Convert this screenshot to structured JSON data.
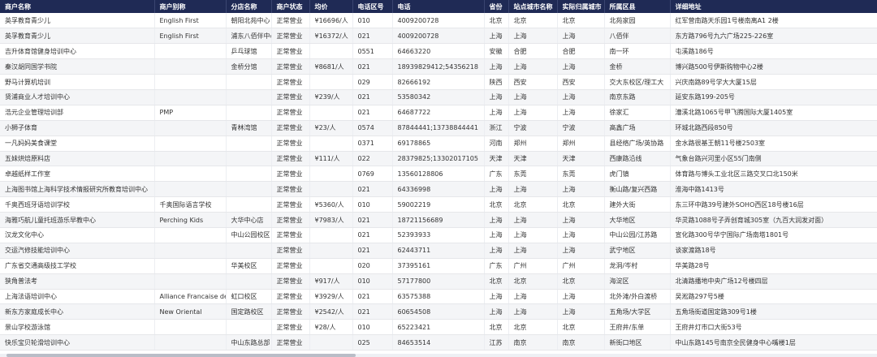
{
  "table": {
    "columns": [
      "商户名称",
      "商户别称",
      "分店名称",
      "商户状态",
      "均价",
      "电话区号",
      "电话",
      "省份",
      "站点城市名称",
      "实际归属城市",
      "所属区县",
      "详细地址"
    ],
    "rows": [
      [
        "英孚教育青少儿",
        "English First",
        "朝阳北苑中心",
        "正常营业",
        "¥16696/人",
        "010",
        "4009200728",
        "北京",
        "北京",
        "北京",
        "北苑家园",
        "红军营南路天乐园1号楼南离A1 2楼"
      ],
      [
        "英孚教育青少儿",
        "English First",
        "浦东八佰伴中心",
        "正常营业",
        "¥16372/人",
        "021",
        "4009200728",
        "上海",
        "上海",
        "上海",
        "八佰伴",
        "东方路796号九六广场225-226室"
      ],
      [
        "吉升体育馆健身培训中心",
        "",
        "乒乓球馆",
        "正常营业",
        "",
        "0551",
        "64663220",
        "安徽",
        "合肥",
        "合肥",
        "南一环",
        "屯溪路186号"
      ],
      [
        "秦汉胡同国学书院",
        "",
        "金桥分馆",
        "正常营业",
        "¥8681/人",
        "021",
        "18939829412;54356218",
        "上海",
        "上海",
        "上海",
        "金桥",
        "博兴路500号伊斯购物中心2楼"
      ],
      [
        "野马计算机培训",
        "",
        "",
        "正常营业",
        "",
        "029",
        "82666192",
        "陕西",
        "西安",
        "西安",
        "交大东校区/理工大",
        "兴庆南路89号学大大厦15层"
      ],
      [
        "贤浦商业人才培训中心",
        "",
        "",
        "正常营业",
        "¥239/人",
        "021",
        "53580342",
        "上海",
        "上海",
        "上海",
        "南京东路",
        "延安东路199-205号"
      ],
      [
        "浩元企业管理培训部",
        "PMP",
        "",
        "正常营业",
        "",
        "021",
        "64687722",
        "上海",
        "上海",
        "上海",
        "徐家汇",
        "漕溪北路1065号甲飞腾国际大厦1405室"
      ],
      [
        "小狮子体育",
        "",
        "青林湾馆",
        "正常营业",
        "¥23/人",
        "0574",
        "87844441;13738844441",
        "浙江",
        "宁波",
        "宁波",
        "高鑫广场",
        "环城北路西段850号"
      ],
      [
        "一凡妈妈美食课堂",
        "",
        "",
        "正常营业",
        "",
        "0371",
        "69178865",
        "河南",
        "郑州",
        "郑州",
        "县经络广场/英协路",
        "金水路很基王朝11号楼2503室"
      ],
      [
        "五妹烘焙原料店",
        "",
        "",
        "正常营业",
        "¥111/人",
        "022",
        "28379825;13302017105",
        "天津",
        "天津",
        "天津",
        "西康路沿线",
        "气象台路兴河里小区55门南侧"
      ],
      [
        "卓越纸样工作室",
        "",
        "",
        "正常营业",
        "",
        "0769",
        "13560128806",
        "广东",
        "东莞",
        "东莞",
        "虎门镇",
        "体育路与博头工业北区三路交叉口北150米"
      ],
      [
        "上海图书馆上海科学技术情报研究所教育培训中心",
        "",
        "",
        "正常营业",
        "",
        "021",
        "64336998",
        "上海",
        "上海",
        "上海",
        "衡山路/复兴西路",
        "淮海中路1413号"
      ],
      [
        "千奥西班牙语培训学校",
        "千奥国际语言学校",
        "",
        "正常营业",
        "¥5360/人",
        "010",
        "59002219",
        "北京",
        "北京",
        "北京",
        "建外大街",
        "东三环中路39号建外SOHO西区18号楼16层"
      ],
      [
        "海雅巧航儿童托班游乐早教中心",
        "Perching Kids",
        "大华中心店",
        "正常营业",
        "¥7983/人",
        "021",
        "18721156689",
        "上海",
        "上海",
        "上海",
        "大华地区",
        "华灵路1088号子弄创育城305室（九百大润发对面）"
      ],
      [
        "汉龙文化中心",
        "",
        "中山公园校区",
        "正常营业",
        "",
        "021",
        "52393933",
        "上海",
        "上海",
        "上海",
        "中山公园/江苏路",
        "宣化路300号华宁国际广场南塔1801号"
      ],
      [
        "交运汽修技能培训中心",
        "",
        "",
        "正常营业",
        "",
        "021",
        "62443711",
        "上海",
        "上海",
        "上海",
        "武宁地区",
        "谈家渡路18号"
      ],
      [
        "广东省交通高级技工学校",
        "",
        "华美校区",
        "正常营业",
        "",
        "020",
        "37395161",
        "广东",
        "广州",
        "广州",
        "龙洞/岑村",
        "华美路28号"
      ],
      [
        "狭角普法考",
        "",
        "",
        "正常营业",
        "¥917/人",
        "010",
        "57177800",
        "北京",
        "北京",
        "北京",
        "海淀区",
        "北清路播地中央广场12号楼四层"
      ],
      [
        "上海法语培训中心",
        "Alliance Francaise de Shanghai",
        "虹口校区",
        "正常营业",
        "¥3929/人",
        "021",
        "63575388",
        "上海",
        "上海",
        "上海",
        "北外滩/外白渡桥",
        "吴淞路297号5楼"
      ],
      [
        "新东方家庭成长中心",
        "New Oriental",
        "国定路校区",
        "正常营业",
        "¥2542/人",
        "021",
        "60654508",
        "上海",
        "上海",
        "上海",
        "五角场/大学区",
        "五角场街道国定路309号1楼"
      ],
      [
        "景山学校游泳馆",
        "",
        "",
        "正常营业",
        "¥28/人",
        "010",
        "65223421",
        "北京",
        "北京",
        "北京",
        "王府井/东单",
        "王府井灯市口大街53号"
      ],
      [
        "快乐宝贝轮滑培训中心",
        "",
        "中山东路总部",
        "正常营业",
        "",
        "025",
        "84653514",
        "江苏",
        "南京",
        "南京",
        "新街口地区",
        "中山东路145号南京全民健身中心嘴楼1层"
      ]
    ]
  }
}
